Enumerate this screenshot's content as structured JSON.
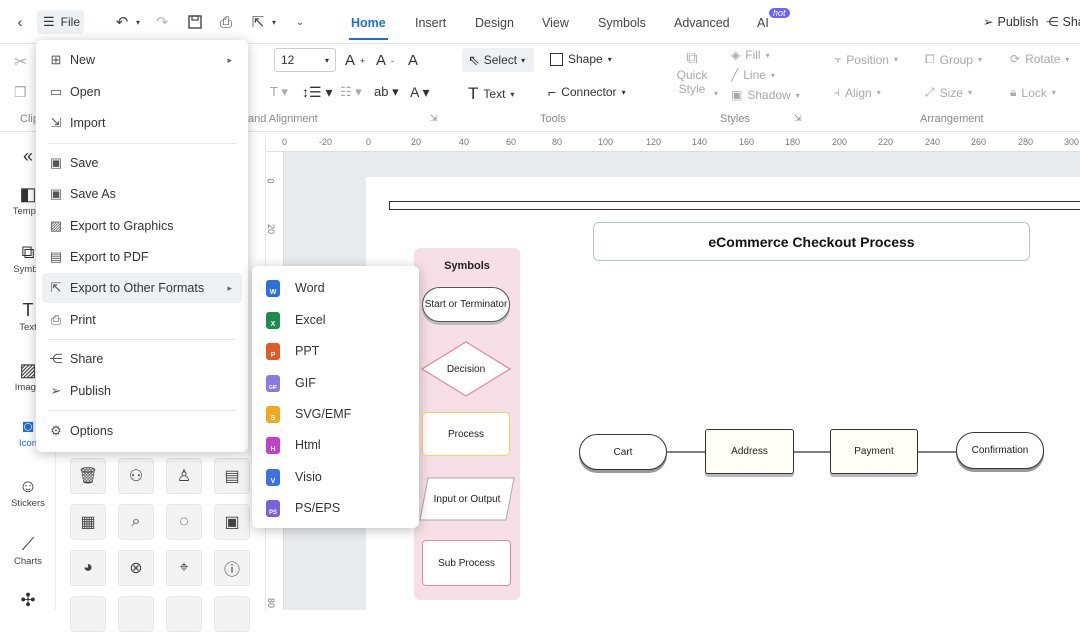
{
  "header": {
    "file_label": "File",
    "tabs": [
      {
        "label": "Home"
      },
      {
        "label": "Insert"
      },
      {
        "label": "Design"
      },
      {
        "label": "View"
      },
      {
        "label": "Symbols"
      },
      {
        "label": "Advanced"
      },
      {
        "label": "AI"
      }
    ],
    "ai_badge": "hot",
    "publish_label": "Publish",
    "share_label": "Sha"
  },
  "ribbon": {
    "font_size": "12",
    "clip_label": "Clip",
    "font_align_group": "and Alignment",
    "select_label": "Select",
    "shape_label": "Shape",
    "text_label": "Text",
    "connector_label": "Connector",
    "tools_group": "Tools",
    "quick_style_1": "Quick",
    "quick_style_2": "Style",
    "fill_label": "Fill",
    "line_label": "Line",
    "shadow_label": "Shadow",
    "styles_group": "Styles",
    "position_label": "Position",
    "group_label": "Group",
    "rotate_label": "Rotate",
    "align_label": "Align",
    "size_label": "Size",
    "lock_label": "Lock",
    "arrangement_group": "Arrangement"
  },
  "leftbar": {
    "items": [
      {
        "label": "Templa"
      },
      {
        "label": "Symbo"
      },
      {
        "label": "Text"
      },
      {
        "label": "Image"
      },
      {
        "label": "Icon"
      },
      {
        "label": "Stickers"
      },
      {
        "label": "Charts"
      }
    ]
  },
  "rulers": {
    "h_ticks": [
      "0",
      "-20",
      "0",
      "20",
      "40",
      "60",
      "80",
      "100",
      "120",
      "140",
      "160",
      "180",
      "200",
      "220",
      "240",
      "260",
      "280",
      "300"
    ],
    "v_ticks": [
      "0",
      "20",
      "80"
    ]
  },
  "file_menu": {
    "items": [
      {
        "label": "New",
        "icon": "plus-square-icon"
      },
      {
        "label": "Open",
        "icon": "folder-icon"
      },
      {
        "label": "Import",
        "icon": "import-icon"
      },
      {
        "label": "Save",
        "icon": "save-icon"
      },
      {
        "label": "Save As",
        "icon": "save-as-icon"
      },
      {
        "label": "Export to Graphics",
        "icon": "image-icon"
      },
      {
        "label": "Export to PDF",
        "icon": "pdf-icon"
      },
      {
        "label": "Export to Other Formats",
        "icon": "export-icon"
      },
      {
        "label": "Print",
        "icon": "print-icon"
      },
      {
        "label": "Share",
        "icon": "share-icon"
      },
      {
        "label": "Publish",
        "icon": "publish-icon"
      },
      {
        "label": "Options",
        "icon": "gear-icon"
      }
    ]
  },
  "export_submenu": {
    "items": [
      {
        "label": "Word",
        "color": "#2f6fd8",
        "letter": "W"
      },
      {
        "label": "Excel",
        "color": "#1f8b4c",
        "letter": "X"
      },
      {
        "label": "PPT",
        "color": "#e05a2b",
        "letter": "P"
      },
      {
        "label": "GIF",
        "color": "#8a7be0",
        "letter": "GIF"
      },
      {
        "label": "SVG/EMF",
        "color": "#f0a821",
        "letter": "S"
      },
      {
        "label": "Html",
        "color": "#c23fc9",
        "letter": "H"
      },
      {
        "label": "Visio",
        "color": "#3f6fe0",
        "letter": "V"
      },
      {
        "label": "PS/EPS",
        "color": "#7b62d8",
        "letter": "PS"
      }
    ]
  },
  "diagram": {
    "title": "eCommerce Checkout Process",
    "symbols_title": "Symbols",
    "symbols": [
      {
        "label": "Start or Terminator"
      },
      {
        "label": "Decision"
      },
      {
        "label": "Process"
      },
      {
        "label": "Input or Output"
      },
      {
        "label": "Sub Process"
      }
    ],
    "flow": [
      {
        "label": "Cart"
      },
      {
        "label": "Address"
      },
      {
        "label": "Payment"
      },
      {
        "label": "Confirmation"
      }
    ]
  },
  "colors": {
    "accent": "#1f6fd6",
    "symbols_panel_bg": "#f6dfe6",
    "process_border": "#f4d36b",
    "subprocess_border": "#e48a9b"
  }
}
